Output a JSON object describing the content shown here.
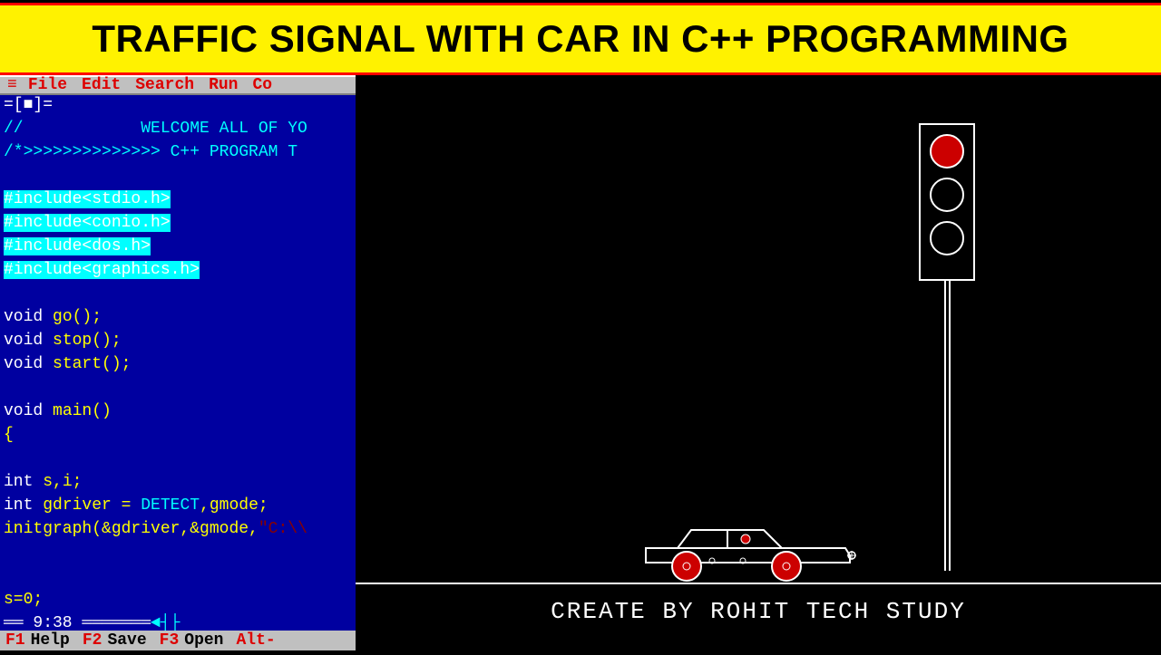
{
  "banner": {
    "title": "TRAFFIC SIGNAL WITH CAR IN C++ PROGRAMMING"
  },
  "menubar": {
    "items": [
      "File",
      "Edit",
      "Search",
      "Run",
      "Co"
    ]
  },
  "window": {
    "title_mark": "=[■]="
  },
  "code": {
    "comment1": "//            WELCOME ALL OF YO",
    "comment2": "/*>>>>>>>>>>>>>> C++ PROGRAM T",
    "inc1": "#include<stdio.h>",
    "inc2": "#include<conio.h>",
    "inc3": "#include<dos.h>",
    "inc4": "#include<graphics.h>",
    "proto1_kw": "void ",
    "proto1_fn": "go",
    "proto1_rest": "();",
    "proto2_kw": "void ",
    "proto2_fn": "stop",
    "proto2_rest": "();",
    "proto3_kw": "void ",
    "proto3_fn": "start",
    "proto3_rest": "();",
    "main_kw": "void ",
    "main_fn": "main",
    "main_rest": "()",
    "brace_open": "{",
    "decl1_kw": "int ",
    "decl1_rest": "s,i;",
    "decl2_kw": "int ",
    "decl2_var": "gdriver = ",
    "decl2_const": "DETECT",
    "decl2_rest": ",gmode;",
    "initgraph_fn": "initgraph",
    "initgraph_args1": "(&gdriver,&gmode,",
    "initgraph_str": "\"C:\\\\",
    "assign": "s=0;"
  },
  "statusbar": {
    "time_prefix": "══ ",
    "time": "9:38",
    "time_suffix": " ═══════",
    "arrows": "◄┤├"
  },
  "fkeys": [
    {
      "key": "F1",
      "label": "Help"
    },
    {
      "key": "F2",
      "label": "Save"
    },
    {
      "key": "F3",
      "label": "Open"
    },
    {
      "key": "Alt-",
      "label": ""
    }
  ],
  "graphics": {
    "credit": "CREATE BY ROHIT TECH STUDY",
    "traffic_signal_state": "red"
  }
}
